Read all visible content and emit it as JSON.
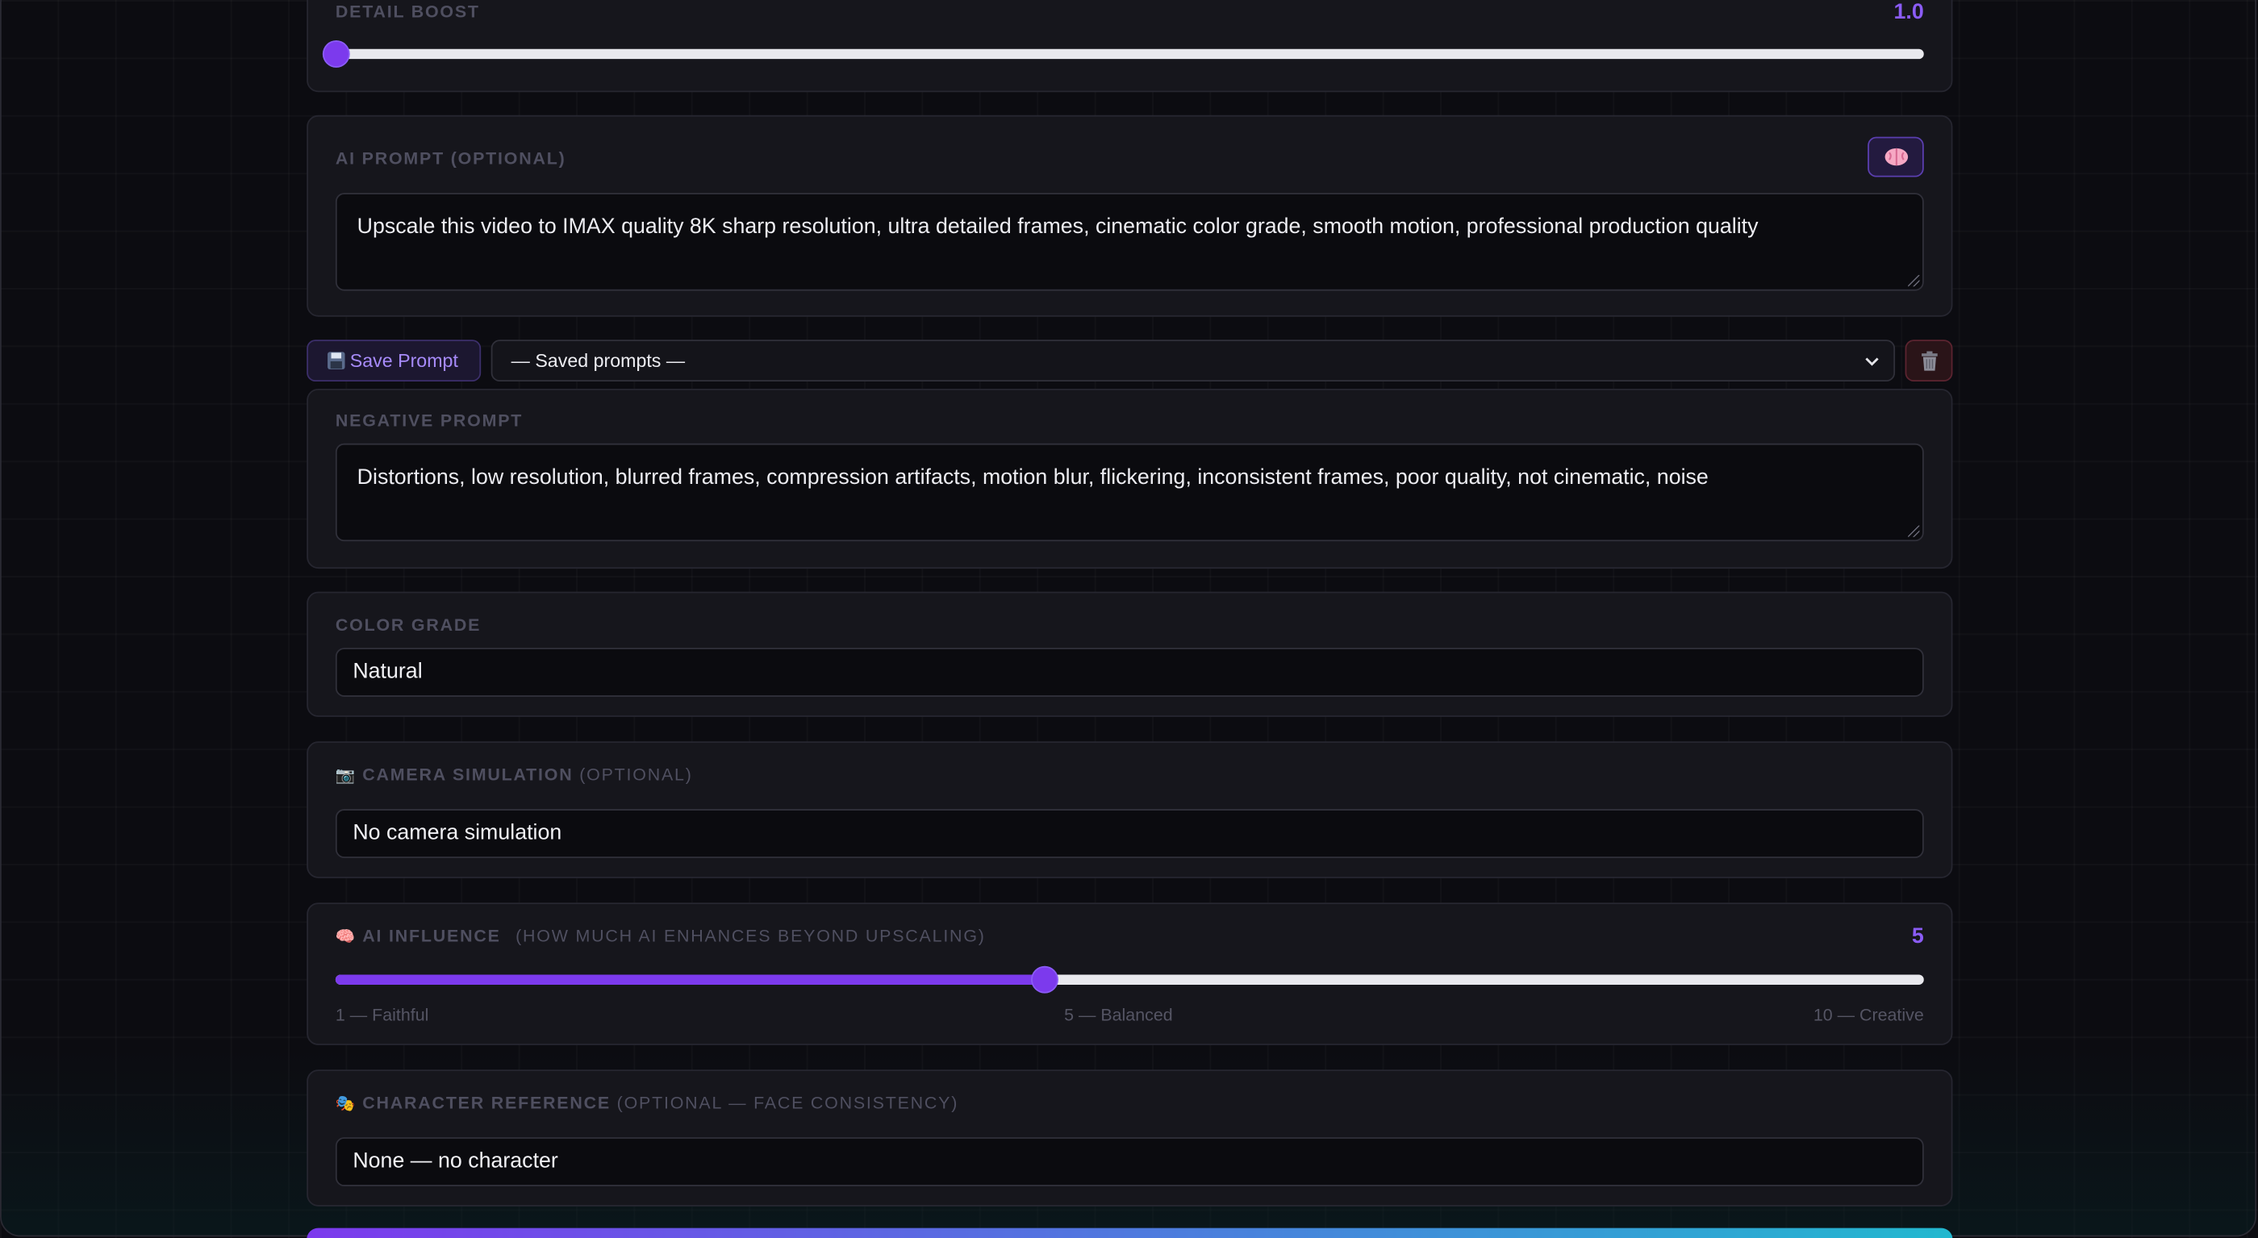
{
  "detail_boost": {
    "label": "DETAIL BOOST",
    "value_text": "1.0",
    "fraction": 0.0
  },
  "ai_prompt": {
    "label": "AI PROMPT (OPTIONAL)",
    "brain_icon": "brain-icon",
    "text": "Upscale this video to IMAX quality 8K sharp resolution, ultra detailed frames, cinematic color grade, smooth motion, professional production quality"
  },
  "prompt_toolbar": {
    "save_label": "Save Prompt",
    "save_icon": "floppy-disk-icon",
    "saved_prompts_selected": "— Saved prompts —",
    "delete_icon": "trash-icon"
  },
  "negative_prompt": {
    "label": "NEGATIVE PROMPT",
    "text": "Distortions, low resolution, blurred frames, compression artifacts, motion blur, flickering, inconsistent frames, poor quality, not cinematic, noise"
  },
  "color_grade": {
    "label": "COLOR GRADE",
    "selected": "Natural"
  },
  "camera_simulation": {
    "icon": "camera-icon",
    "label": "CAMERA SIMULATION",
    "sublabel": "(OPTIONAL)",
    "selected": "No camera simulation"
  },
  "ai_influence": {
    "icon": "brain-icon",
    "label": "AI INFLUENCE",
    "sublabel": "(HOW MUCH AI ENHANCES BEYOND UPSCALING)",
    "value_text": "5",
    "value": 5,
    "min": 1,
    "max": 10,
    "tick_min": "1 — Faithful",
    "tick_mid": "5 — Balanced",
    "tick_max": "10 — Creative"
  },
  "character_reference": {
    "icon": "theater-masks-icon",
    "label": "CHARACTER REFERENCE",
    "sublabel": "(OPTIONAL — FACE CONSISTENCY)",
    "selected": "None — no character"
  },
  "colors": {
    "accent": "#7c3aed",
    "accent_text": "#8b5cf6",
    "gradient_end": "#22b8cf"
  }
}
